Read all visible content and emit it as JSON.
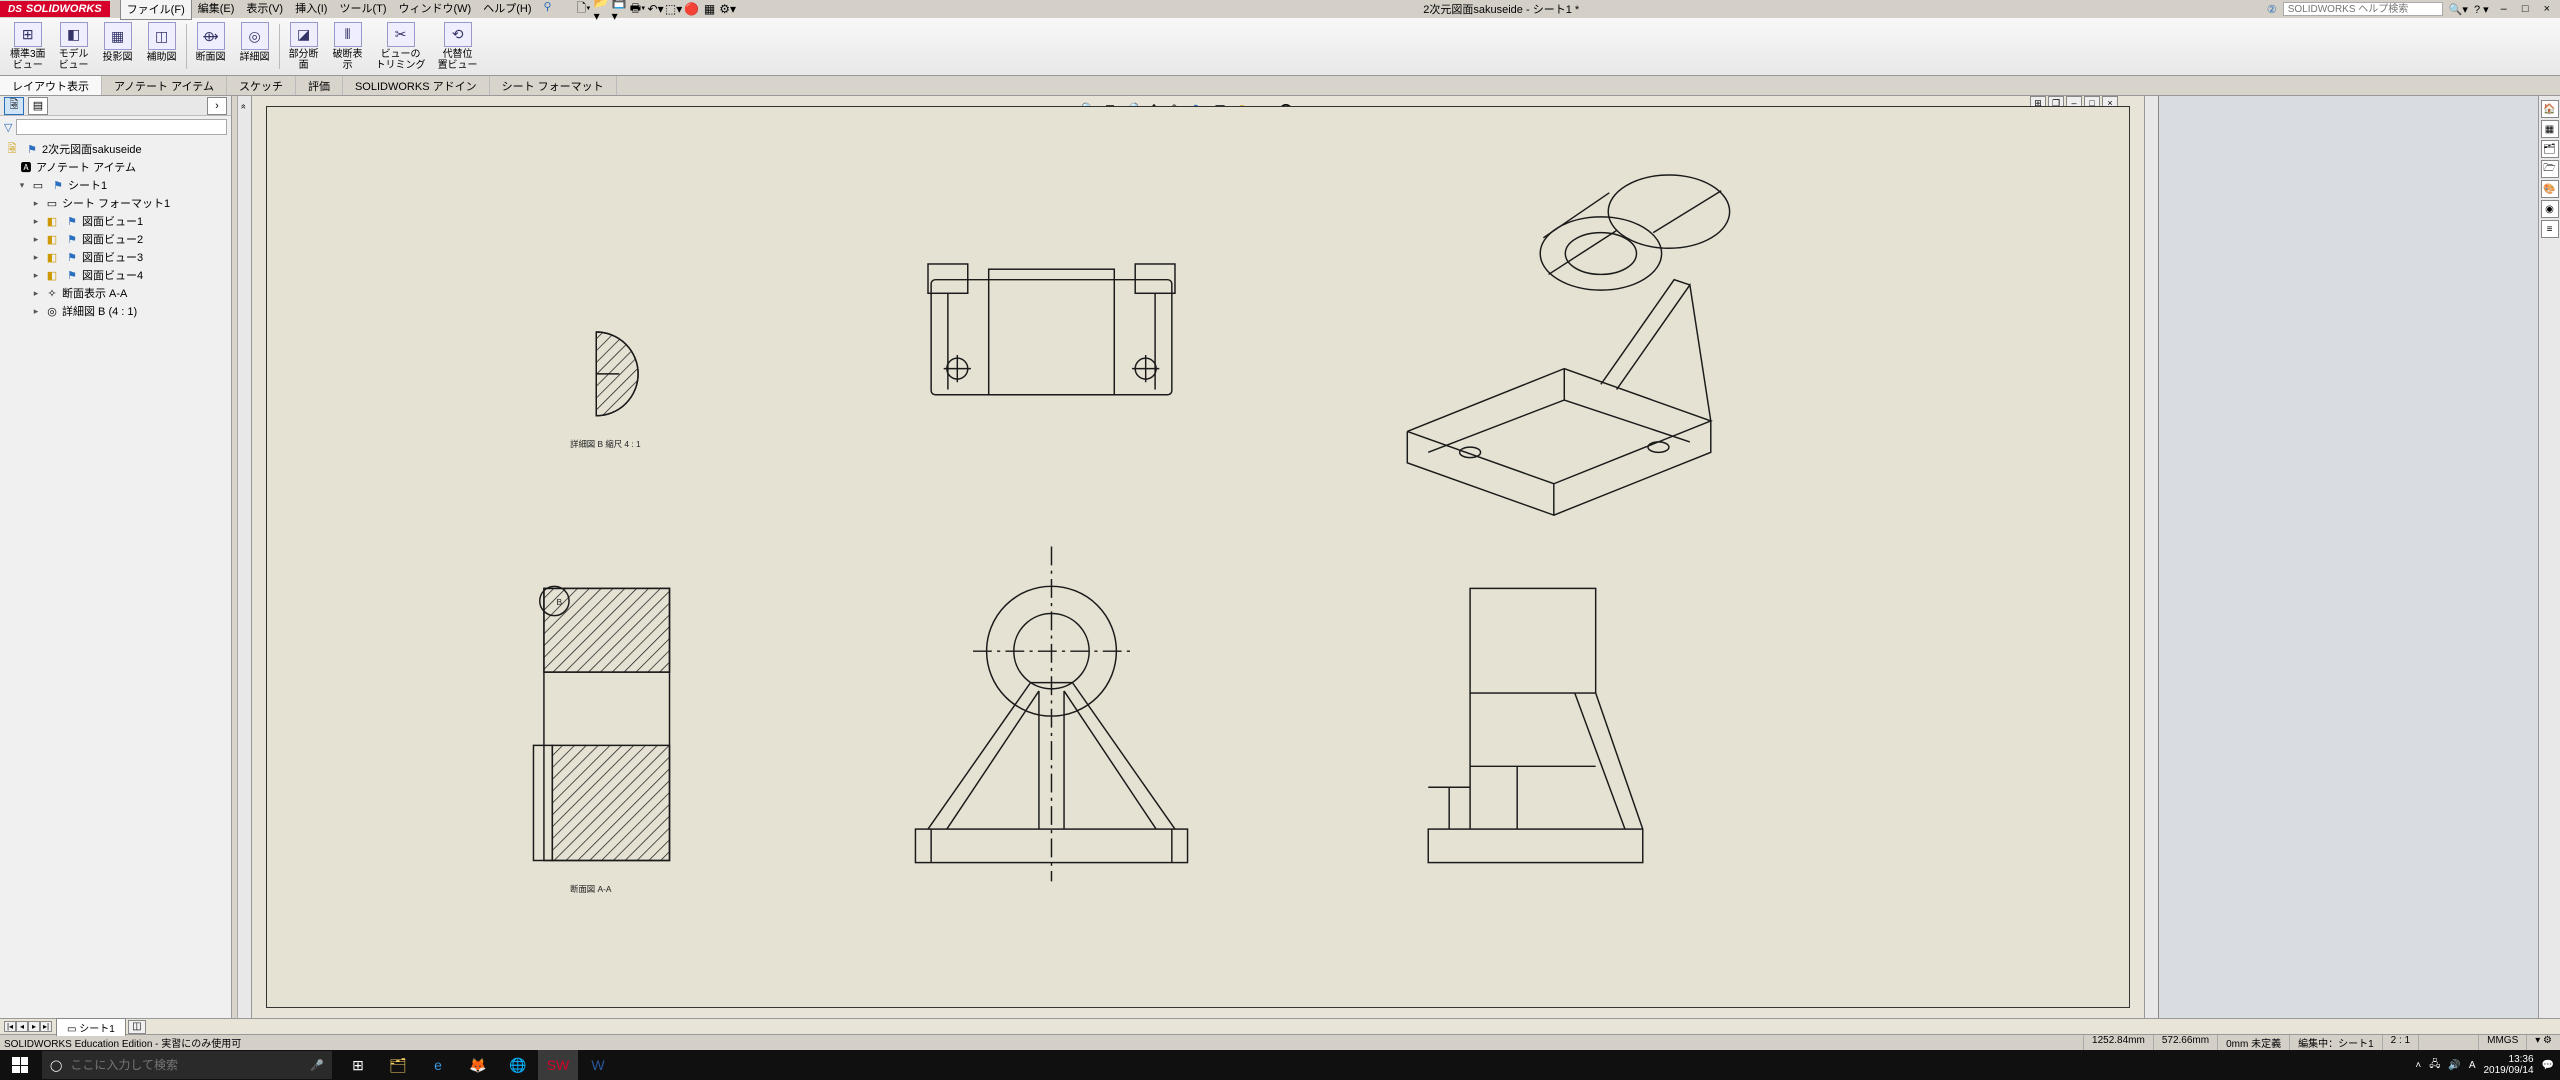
{
  "app": {
    "name": "SOLIDWORKS",
    "doc_title": "2次元図面sakuseide  - シート1 *"
  },
  "menu": [
    "ファイル(F)",
    "編集(E)",
    "表示(V)",
    "挿入(I)",
    "ツール(T)",
    "ウィンドウ(W)",
    "ヘルプ(H)"
  ],
  "search_placeholder": "SOLIDWORKS ヘルプ検索",
  "ribbon": {
    "buttons": [
      {
        "label": "標準3面\nビュー",
        "icon": "⊞"
      },
      {
        "label": "モデル\nビュー",
        "icon": "◧"
      },
      {
        "label": "投影図",
        "icon": "▦"
      },
      {
        "label": "補助図",
        "icon": "◫"
      },
      {
        "label": "断面図",
        "icon": "⟴"
      },
      {
        "label": "詳細図",
        "icon": "◎"
      },
      {
        "label": "部分断\n面",
        "icon": "◪"
      },
      {
        "label": "破断表\n示",
        "icon": "⫴"
      },
      {
        "label": "ビューの\nトリミング",
        "icon": "✂"
      },
      {
        "label": "代替位\n置ビュー",
        "icon": "⟲"
      }
    ]
  },
  "tabs": [
    "レイアウト表示",
    "アノテート アイテム",
    "スケッチ",
    "評価",
    "SOLIDWORKS アドイン",
    "シート フォーマット"
  ],
  "active_tab": 0,
  "tree": {
    "root": "2次元図面sakuseide",
    "annotations": "アノテート アイテム",
    "sheet": "シート1",
    "children": [
      "シート フォーマット1",
      "図面ビュー1",
      "図面ビュー2",
      "図面ビュー3",
      "図面ビュー4",
      "断面表示 A-A",
      "詳細図 B (4 : 1)"
    ]
  },
  "detail_label": "詳細図 B\n縮尺 4 : 1",
  "section_label": "断面図 A-A",
  "sheet_tab": "シート1",
  "status": {
    "edition": "SOLIDWORKS Education Edition - 実習にのみ使用可",
    "x": "1252.84mm",
    "y": "572.66mm",
    "z": "0mm 未定義",
    "editing": "編集中：シート1",
    "scale": "2 : 1",
    "units": "MMGS"
  },
  "taskbar": {
    "search_placeholder": "ここに入力して検索",
    "time": "13:36",
    "date": "2019/09/14"
  }
}
